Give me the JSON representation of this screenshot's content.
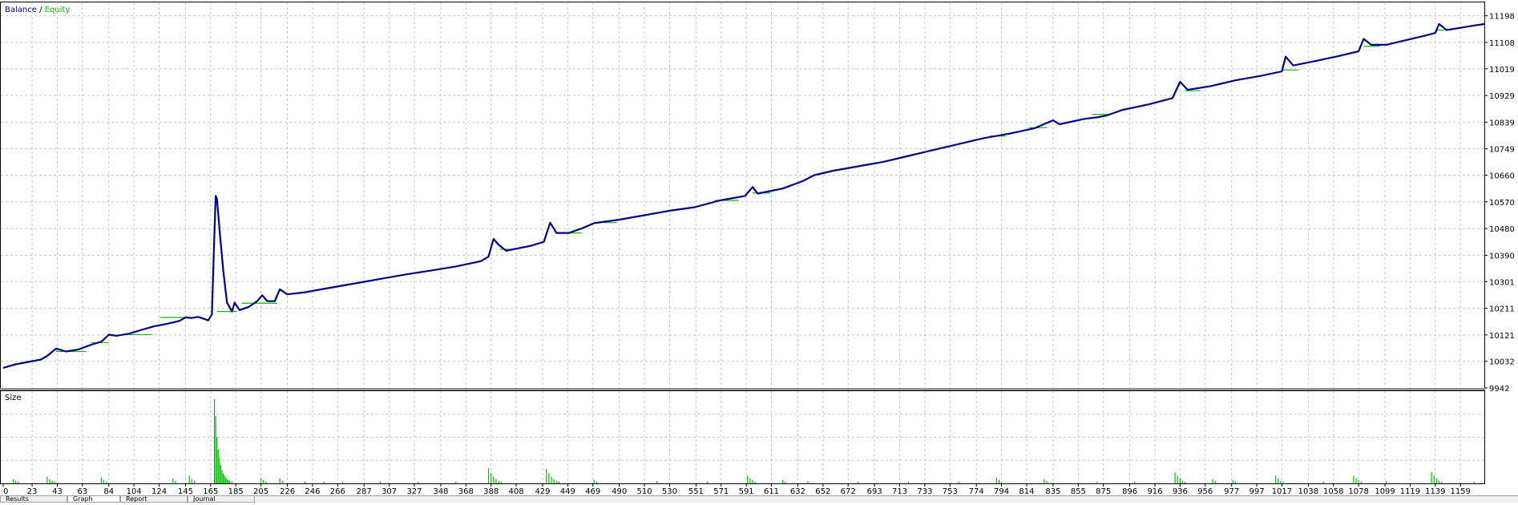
{
  "chart_data": [
    {
      "type": "line",
      "legend": {
        "placement": "top-left",
        "separator": " / "
      },
      "grid": true,
      "series": [
        {
          "name": "Balance",
          "color": "#00008b"
        },
        {
          "name": "Equity",
          "color": "#00c000"
        }
      ],
      "y_ticks": [
        "11198",
        "11108",
        "11019",
        "10929",
        "10839",
        "10749",
        "10660",
        "10570",
        "10480",
        "10390",
        "10301",
        "10211",
        "10121",
        "10032",
        "9942"
      ],
      "ylim": [
        9942,
        11243
      ],
      "xlim": [
        0,
        1178
      ],
      "balance_points": [
        [
          0,
          10010
        ],
        [
          10,
          10022
        ],
        [
          20,
          10030
        ],
        [
          30,
          10038
        ],
        [
          35,
          10050
        ],
        [
          42,
          10075
        ],
        [
          50,
          10065
        ],
        [
          60,
          10072
        ],
        [
          70,
          10088
        ],
        [
          78,
          10098
        ],
        [
          84,
          10122
        ],
        [
          90,
          10118
        ],
        [
          100,
          10125
        ],
        [
          110,
          10138
        ],
        [
          120,
          10150
        ],
        [
          130,
          10158
        ],
        [
          140,
          10168
        ],
        [
          145,
          10180
        ],
        [
          150,
          10178
        ],
        [
          155,
          10182
        ],
        [
          160,
          10175
        ],
        [
          163,
          10170
        ],
        [
          166,
          10190
        ],
        [
          168,
          10470
        ],
        [
          169,
          10590
        ],
        [
          170,
          10580
        ],
        [
          172,
          10480
        ],
        [
          175,
          10340
        ],
        [
          178,
          10230
        ],
        [
          182,
          10200
        ],
        [
          184,
          10230
        ],
        [
          188,
          10205
        ],
        [
          195,
          10215
        ],
        [
          202,
          10235
        ],
        [
          206,
          10255
        ],
        [
          210,
          10235
        ],
        [
          216,
          10235
        ],
        [
          220,
          10275
        ],
        [
          226,
          10258
        ],
        [
          240,
          10265
        ],
        [
          260,
          10280
        ],
        [
          280,
          10295
        ],
        [
          300,
          10310
        ],
        [
          320,
          10325
        ],
        [
          340,
          10338
        ],
        [
          360,
          10352
        ],
        [
          380,
          10370
        ],
        [
          386,
          10385
        ],
        [
          390,
          10445
        ],
        [
          394,
          10425
        ],
        [
          400,
          10405
        ],
        [
          420,
          10422
        ],
        [
          430,
          10435
        ],
        [
          435,
          10500
        ],
        [
          440,
          10465
        ],
        [
          450,
          10465
        ],
        [
          460,
          10480
        ],
        [
          470,
          10498
        ],
        [
          490,
          10510
        ],
        [
          510,
          10525
        ],
        [
          530,
          10540
        ],
        [
          550,
          10552
        ],
        [
          570,
          10575
        ],
        [
          590,
          10590
        ],
        [
          596,
          10620
        ],
        [
          600,
          10598
        ],
        [
          620,
          10615
        ],
        [
          636,
          10640
        ],
        [
          645,
          10660
        ],
        [
          660,
          10675
        ],
        [
          680,
          10690
        ],
        [
          700,
          10705
        ],
        [
          720,
          10725
        ],
        [
          740,
          10745
        ],
        [
          760,
          10765
        ],
        [
          780,
          10785
        ],
        [
          800,
          10800
        ],
        [
          820,
          10818
        ],
        [
          835,
          10845
        ],
        [
          840,
          10832
        ],
        [
          860,
          10850
        ],
        [
          870,
          10855
        ],
        [
          878,
          10862
        ],
        [
          890,
          10880
        ],
        [
          910,
          10898
        ],
        [
          930,
          10920
        ],
        [
          936,
          10975
        ],
        [
          942,
          10948
        ],
        [
          960,
          10960
        ],
        [
          970,
          10970
        ],
        [
          980,
          10980
        ],
        [
          1000,
          10995
        ],
        [
          1017,
          11010
        ],
        [
          1020,
          11060
        ],
        [
          1026,
          11030
        ],
        [
          1040,
          11042
        ],
        [
          1060,
          11060
        ],
        [
          1078,
          11078
        ],
        [
          1082,
          11120
        ],
        [
          1088,
          11100
        ],
        [
          1100,
          11100
        ],
        [
          1115,
          11115
        ],
        [
          1130,
          11130
        ],
        [
          1139,
          11140
        ],
        [
          1142,
          11170
        ],
        [
          1148,
          11150
        ],
        [
          1160,
          11158
        ],
        [
          1170,
          11165
        ],
        [
          1178,
          11170
        ]
      ],
      "equity_flats": [
        [
          42,
          66,
          10065
        ],
        [
          70,
          84,
          10095
        ],
        [
          100,
          118,
          10122
        ],
        [
          125,
          150,
          10180
        ],
        [
          170,
          186,
          10200
        ],
        [
          190,
          218,
          10228
        ],
        [
          395,
          405,
          10410
        ],
        [
          440,
          460,
          10465
        ],
        [
          478,
          488,
          10500
        ],
        [
          566,
          585,
          10575
        ],
        [
          596,
          610,
          10600
        ],
        [
          785,
          797,
          10792
        ],
        [
          816,
          830,
          10820
        ],
        [
          866,
          880,
          10865
        ],
        [
          940,
          952,
          10945
        ],
        [
          1017,
          1030,
          11015
        ],
        [
          1082,
          1095,
          11095
        ],
        [
          1139,
          1152,
          11150
        ]
      ]
    },
    {
      "type": "bar",
      "legend": {
        "placement": "top-left"
      },
      "grid": true,
      "series": [
        {
          "name": "Size",
          "color": "#00c000"
        }
      ],
      "xlim": [
        0,
        1178
      ],
      "ylim": [
        0,
        100
      ],
      "x_ticks": [
        "0",
        "23",
        "43",
        "63",
        "84",
        "104",
        "124",
        "145",
        "165",
        "185",
        "205",
        "226",
        "246",
        "266",
        "287",
        "307",
        "327",
        "348",
        "368",
        "388",
        "408",
        "429",
        "449",
        "469",
        "490",
        "510",
        "530",
        "551",
        "571",
        "591",
        "611",
        "632",
        "652",
        "672",
        "693",
        "713",
        "733",
        "753",
        "774",
        "794",
        "814",
        "835",
        "855",
        "875",
        "896",
        "916",
        "936",
        "956",
        "977",
        "997",
        "1017",
        "1038",
        "1058",
        "1078",
        "1099",
        "1119",
        "1139",
        "1159"
      ],
      "bars": [
        [
          8,
          5
        ],
        [
          10,
          3
        ],
        [
          12,
          2
        ],
        [
          35,
          8
        ],
        [
          37,
          5
        ],
        [
          39,
          3
        ],
        [
          41,
          2
        ],
        [
          78,
          7
        ],
        [
          80,
          4
        ],
        [
          82,
          2
        ],
        [
          135,
          6
        ],
        [
          137,
          3
        ],
        [
          148,
          9
        ],
        [
          150,
          5
        ],
        [
          152,
          3
        ],
        [
          168,
          100
        ],
        [
          169,
          80
        ],
        [
          170,
          55
        ],
        [
          171,
          40
        ],
        [
          172,
          30
        ],
        [
          173,
          22
        ],
        [
          174,
          16
        ],
        [
          175,
          12
        ],
        [
          176,
          9
        ],
        [
          177,
          7
        ],
        [
          178,
          5
        ],
        [
          179,
          4
        ],
        [
          180,
          3
        ],
        [
          182,
          2
        ],
        [
          205,
          7
        ],
        [
          207,
          4
        ],
        [
          209,
          2
        ],
        [
          220,
          6
        ],
        [
          222,
          3
        ],
        [
          240,
          2
        ],
        [
          255,
          2
        ],
        [
          270,
          2
        ],
        [
          300,
          2
        ],
        [
          330,
          2
        ],
        [
          360,
          2
        ],
        [
          386,
          18
        ],
        [
          388,
          12
        ],
        [
          390,
          8
        ],
        [
          392,
          5
        ],
        [
          394,
          3
        ],
        [
          396,
          2
        ],
        [
          432,
          17
        ],
        [
          434,
          12
        ],
        [
          436,
          8
        ],
        [
          438,
          5
        ],
        [
          440,
          3
        ],
        [
          442,
          2
        ],
        [
          470,
          4
        ],
        [
          472,
          2
        ],
        [
          520,
          3
        ],
        [
          560,
          2
        ],
        [
          592,
          9
        ],
        [
          594,
          6
        ],
        [
          596,
          4
        ],
        [
          598,
          2
        ],
        [
          620,
          4
        ],
        [
          622,
          2
        ],
        [
          640,
          3
        ],
        [
          680,
          2
        ],
        [
          720,
          2
        ],
        [
          760,
          2
        ],
        [
          790,
          7
        ],
        [
          792,
          4
        ],
        [
          794,
          2
        ],
        [
          828,
          5
        ],
        [
          830,
          3
        ],
        [
          870,
          2
        ],
        [
          900,
          2
        ],
        [
          932,
          13
        ],
        [
          934,
          9
        ],
        [
          936,
          6
        ],
        [
          938,
          3
        ],
        [
          940,
          2
        ],
        [
          962,
          5
        ],
        [
          964,
          3
        ],
        [
          978,
          4
        ],
        [
          980,
          2
        ],
        [
          1012,
          9
        ],
        [
          1014,
          6
        ],
        [
          1016,
          3
        ],
        [
          1018,
          2
        ],
        [
          1050,
          2
        ],
        [
          1074,
          9
        ],
        [
          1076,
          6
        ],
        [
          1078,
          4
        ],
        [
          1080,
          2
        ],
        [
          1100,
          3
        ],
        [
          1136,
          13
        ],
        [
          1138,
          9
        ],
        [
          1140,
          6
        ],
        [
          1142,
          3
        ],
        [
          1144,
          2
        ],
        [
          1170,
          2
        ]
      ]
    }
  ],
  "tabs": [
    "Results",
    "Graph",
    "Report",
    "Journal"
  ]
}
